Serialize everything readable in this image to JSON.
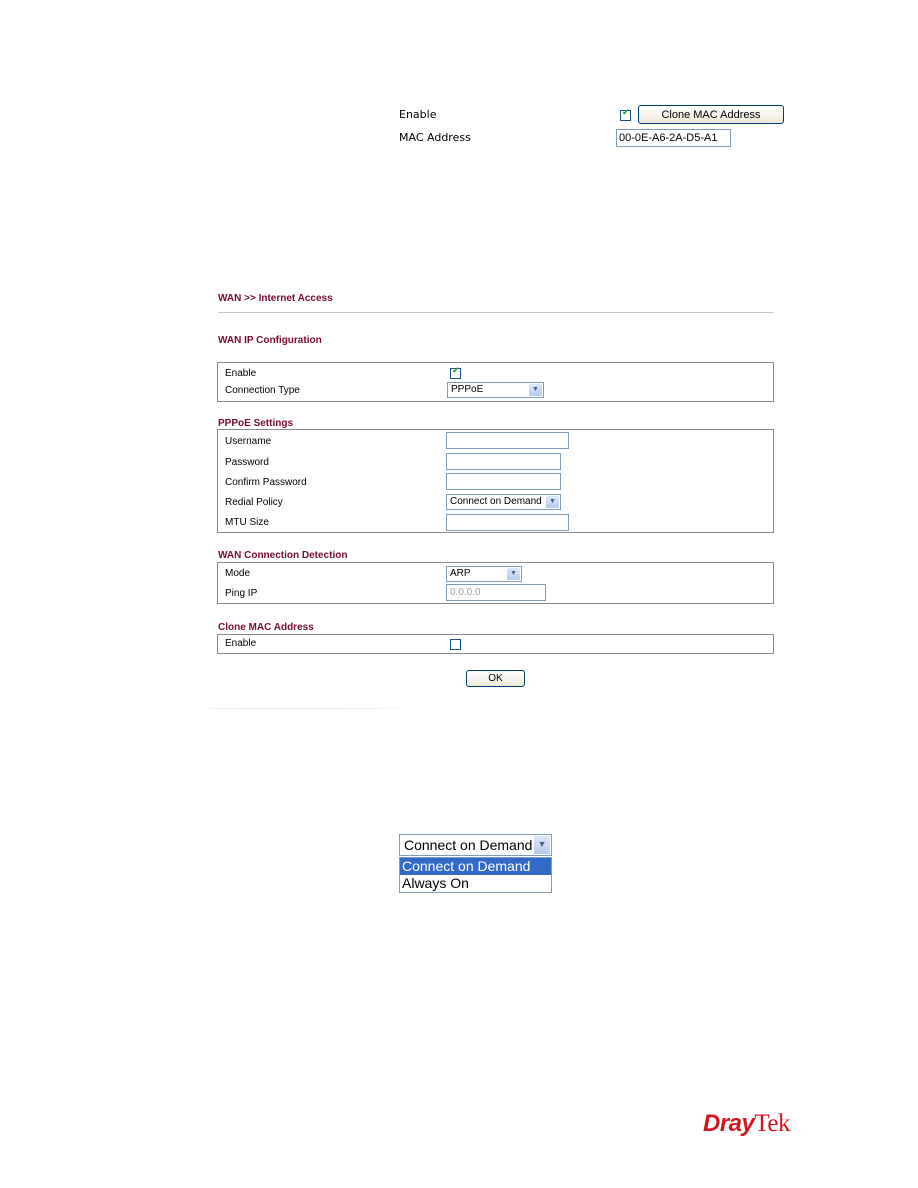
{
  "clone_mac_snippet": {
    "enable_label": "Enable",
    "enable_checked": true,
    "clone_button_label": "Clone MAC Address",
    "mac_label": "MAC Address",
    "mac_value": "00-0E-A6-2A-D5-A1"
  },
  "page": {
    "breadcrumb": "WAN >> Internet Access",
    "sections": {
      "wan_ip": {
        "title": "WAN IP Configuration",
        "enable_label": "Enable",
        "enable_checked": true,
        "connection_type_label": "Connection Type",
        "connection_type_value": "PPPoE"
      },
      "pppoe": {
        "title": "PPPoE Settings",
        "username_label": "Username",
        "username_value": "",
        "password_label": "Password",
        "password_value": "",
        "confirm_password_label": "Confirm Password",
        "confirm_password_value": "",
        "redial_policy_label": "Redial Policy",
        "redial_policy_value": "Connect on Demand",
        "mtu_label": "MTU Size",
        "mtu_value": ""
      },
      "detection": {
        "title": "WAN Connection Detection",
        "mode_label": "Mode",
        "mode_value": "ARP",
        "ping_ip_label": "Ping IP",
        "ping_ip_value": "0.0.0.0"
      },
      "clone_mac": {
        "title": "Clone MAC Address",
        "enable_label": "Enable",
        "enable_checked": false
      }
    },
    "ok_label": "OK"
  },
  "redial_dropdown": {
    "selected": "Connect on Demand",
    "options": [
      "Connect on Demand",
      "Always On"
    ],
    "highlighted_index": 0
  },
  "logo": {
    "part1": "Dray",
    "part2": "Tek",
    "color": "#d1161f"
  },
  "icons": {
    "dropdown_arrow": "chevron-down-icon",
    "checkmark": "check-icon"
  }
}
